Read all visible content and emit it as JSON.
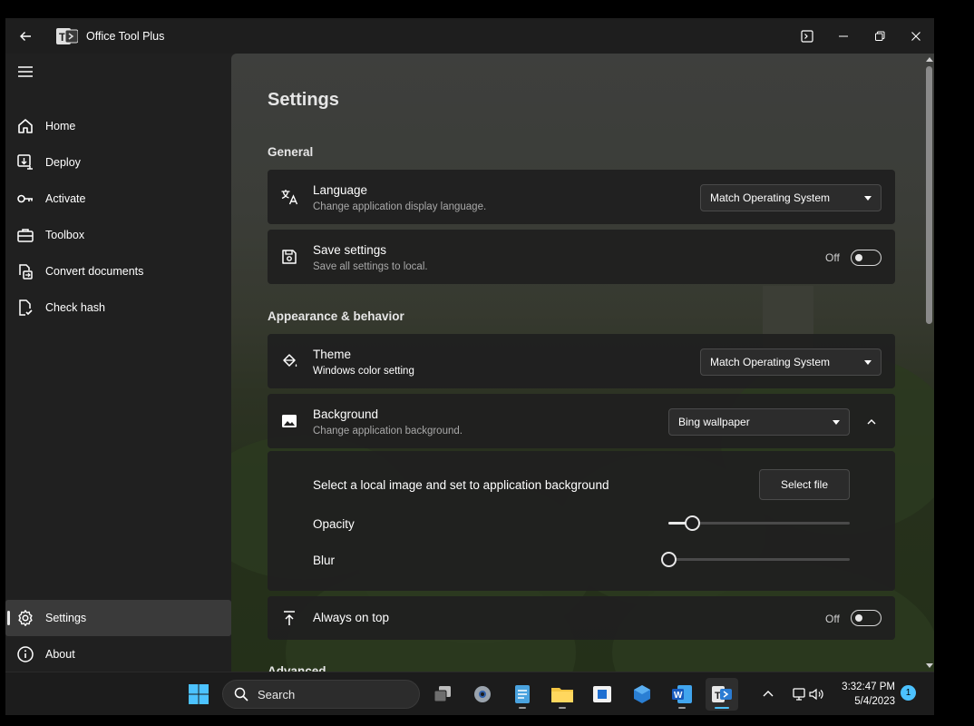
{
  "window": {
    "title": "Office Tool Plus"
  },
  "sidebar": {
    "items": [
      {
        "label": "Home",
        "icon": "home-icon"
      },
      {
        "label": "Deploy",
        "icon": "deploy-icon"
      },
      {
        "label": "Activate",
        "icon": "key-icon"
      },
      {
        "label": "Toolbox",
        "icon": "toolbox-icon"
      },
      {
        "label": "Convert documents",
        "icon": "convert-icon"
      },
      {
        "label": "Check hash",
        "icon": "check-document-icon"
      }
    ],
    "footer": [
      {
        "label": "Settings",
        "icon": "gear-icon",
        "selected": true
      },
      {
        "label": "About",
        "icon": "info-icon"
      }
    ]
  },
  "settings": {
    "page_title": "Settings",
    "general": {
      "title": "General",
      "language": {
        "title": "Language",
        "subtitle": "Change application display language.",
        "value": "Match Operating System"
      },
      "save_settings": {
        "title": "Save settings",
        "subtitle": "Save all settings to local.",
        "state": "Off"
      }
    },
    "appearance": {
      "title": "Appearance & behavior",
      "theme": {
        "title": "Theme",
        "subtitle": "Windows color setting",
        "value": "Match Operating System"
      },
      "background": {
        "title": "Background",
        "subtitle": "Change application background.",
        "value": "Bing wallpaper",
        "local_image_label": "Select a local image and set to application background",
        "select_file_label": "Select file",
        "opacity_label": "Opacity",
        "opacity_value": 0.13,
        "blur_label": "Blur",
        "blur_value": 0
      },
      "always_on_top": {
        "title": "Always on top",
        "state": "Off"
      }
    },
    "advanced": {
      "title": "Advanced"
    }
  },
  "taskbar": {
    "search_label": "Search",
    "time": "3:32:47 PM",
    "date": "5/4/2023",
    "notifications": "1"
  },
  "colors": {
    "accent": "#4cc2ff",
    "card": "#202020",
    "sidebar": "#202020"
  }
}
